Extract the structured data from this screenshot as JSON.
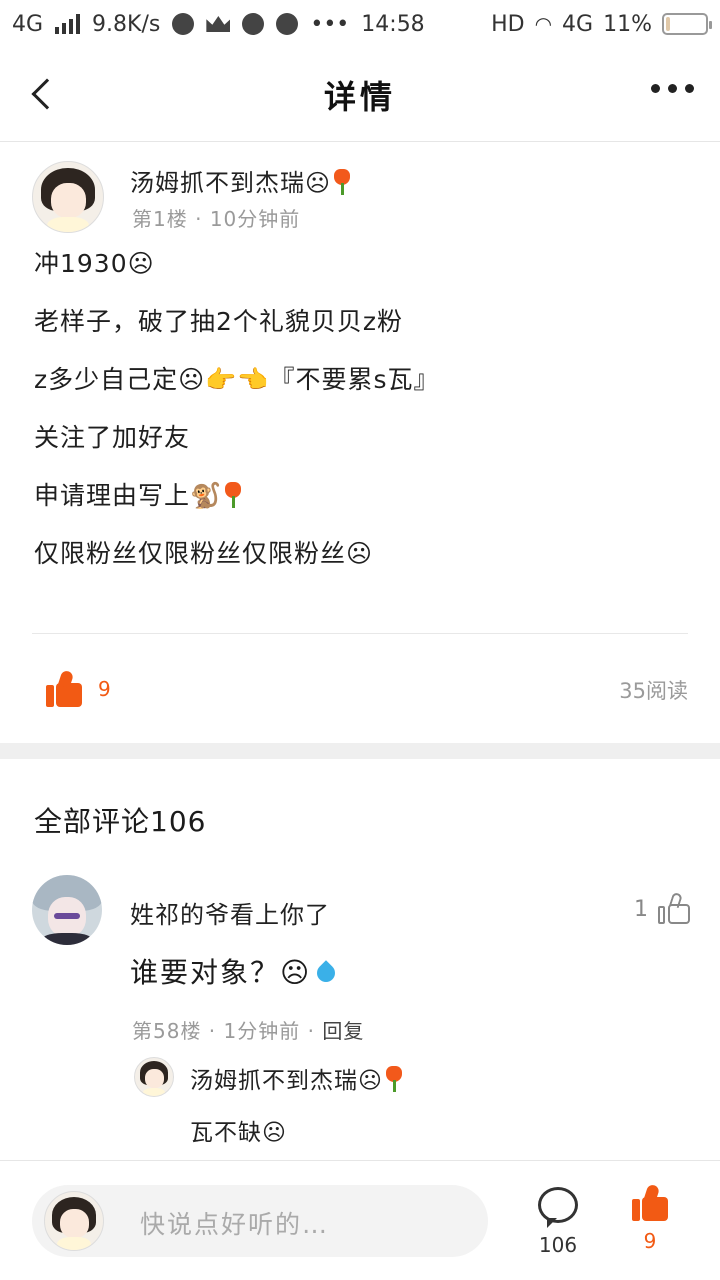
{
  "status_bar": {
    "network": "4G",
    "speed": "9.8K/s",
    "time": "14:58",
    "hd": "HD",
    "network_right": "4G",
    "battery_percent": "11%",
    "battery_level": 0.11
  },
  "nav": {
    "title": "详情",
    "back_icon": "chevron-left-icon",
    "more_icon": "more-dots-icon"
  },
  "post": {
    "author": "汤姆抓不到杰瑞☹",
    "floor": "第1楼",
    "time": "10分钟前",
    "lines": [
      "冲1930☹",
      "老样子，破了抽2个礼貌贝贝z粉",
      "z多少自己定☹👉👈『不要累s瓦』",
      "关注了加好友",
      "申请理由写上🐒",
      "仅限粉丝仅限粉丝仅限粉丝☹"
    ],
    "like_count": "9",
    "read_count": "35阅读"
  },
  "comments": {
    "title": "全部评论106",
    "items": [
      {
        "author": "姓祁的爷看上你了",
        "text": "谁要对象？☹",
        "floor": "第58楼",
        "time": "1分钟前",
        "reply_label": "回复",
        "like_count": "1",
        "reply": {
          "author": "汤姆抓不到杰瑞☹",
          "text": "瓦不缺☹"
        }
      }
    ]
  },
  "bottom_bar": {
    "input_placeholder": "快说点好听的…",
    "comment_count": "106",
    "like_count": "9"
  },
  "colors": {
    "accent": "#f25a14",
    "muted": "#9a9a9a",
    "separator": "#efefef"
  }
}
